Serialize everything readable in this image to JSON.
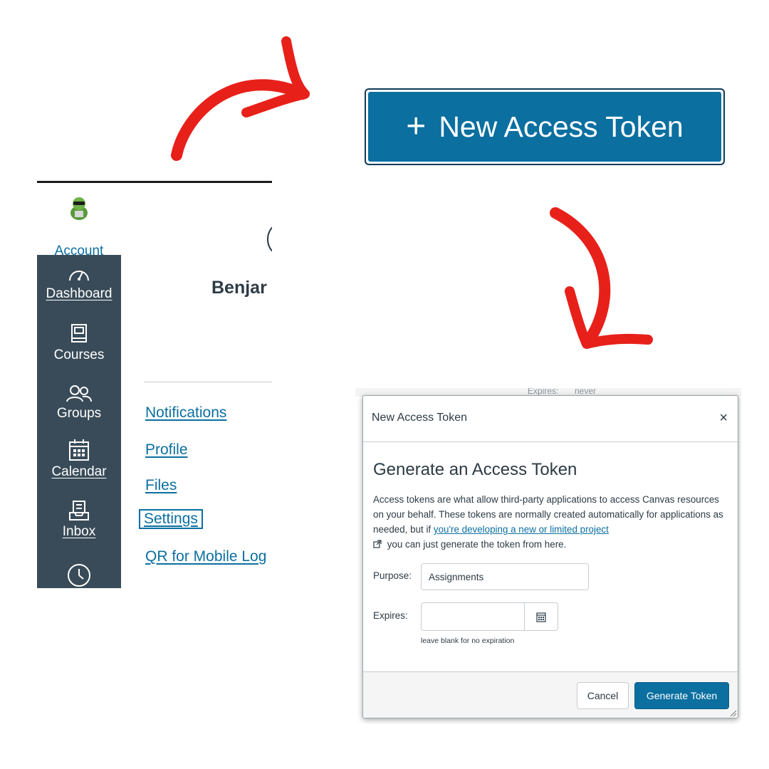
{
  "big_button": {
    "label": "New Access Token"
  },
  "sidebar": {
    "account": "Account",
    "items": [
      {
        "label": "Dashboard",
        "icon": "dashboard-icon"
      },
      {
        "label": "Courses",
        "icon": "courses-icon"
      },
      {
        "label": "Groups",
        "icon": "groups-icon"
      },
      {
        "label": "Calendar",
        "icon": "calendar-icon"
      },
      {
        "label": "Inbox",
        "icon": "inbox-icon"
      }
    ]
  },
  "profile": {
    "name": "Benjar"
  },
  "account_links": [
    {
      "label": "Notifications"
    },
    {
      "label": "Profile"
    },
    {
      "label": "Files"
    },
    {
      "label": "Settings"
    },
    {
      "label": "QR for Mobile Log"
    }
  ],
  "background_text": {
    "expires_label": "Expires:",
    "expires_value": "never"
  },
  "modal": {
    "title": "New Access Token",
    "close": "×",
    "heading": "Generate an Access Token",
    "desc_before": "Access tokens are what allow third-party applications to access Canvas resources on your behalf. These tokens are normally created automatically for applications as needed, but if ",
    "desc_link": "you're developing a new or limited project",
    "desc_after": " you can just generate the token from here.",
    "purpose_label": "Purpose:",
    "purpose_value": "Assignments",
    "expires_label": "Expires:",
    "expires_value": "",
    "expires_hint": "leave blank for no expiration",
    "cancel": "Cancel",
    "generate": "Generate Token"
  },
  "colors": {
    "arrow": "#e8201a",
    "canvas_blue": "#0b6fa0",
    "nav_bg": "#394b58"
  }
}
